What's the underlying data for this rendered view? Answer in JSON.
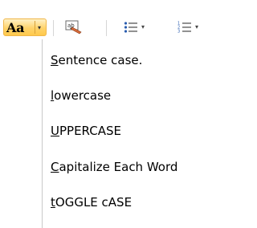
{
  "toolbar": {
    "change_case_label": "Aa",
    "change_case_arrow": "▾",
    "bullets_arrow": "▾",
    "numbering_arrow": "▾"
  },
  "icons": {
    "phonetic": "phonetic-guide-icon",
    "bullets": "bullets-list-icon",
    "numbering": "numbered-list-icon"
  },
  "menu": {
    "items": [
      {
        "accel": "S",
        "rest": "entence case."
      },
      {
        "accel": "l",
        "rest": "owercase"
      },
      {
        "accel": "U",
        "rest": "PPERCASE"
      },
      {
        "accel": "C",
        "rest": "apitalize Each Word"
      },
      {
        "accel": "t",
        "rest": "OGGLE cASE"
      }
    ]
  },
  "colors": {
    "active_button": "#ffd36b",
    "active_border": "#f0b74a",
    "list_icon_blue": "#2a5db0"
  }
}
